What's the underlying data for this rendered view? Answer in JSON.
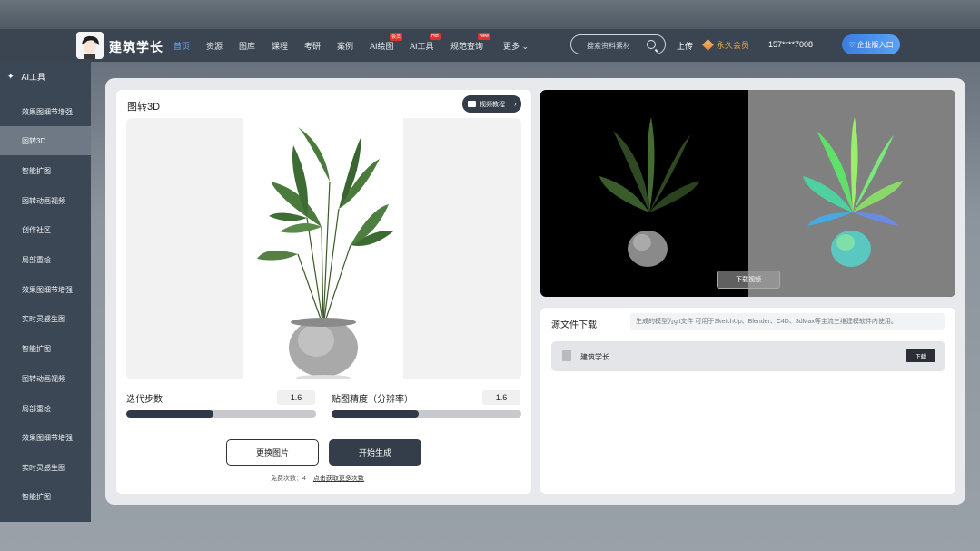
{
  "brand": {
    "name": "建筑学长"
  },
  "nav": {
    "items": [
      {
        "label": "首页",
        "active": true
      },
      {
        "label": "资源"
      },
      {
        "label": "图库"
      },
      {
        "label": "课程"
      },
      {
        "label": "考研"
      },
      {
        "label": "案例"
      },
      {
        "label": "AI绘图",
        "badge": "会员"
      },
      {
        "label": "AI工具",
        "badge": "Hot"
      },
      {
        "label": "规范查询",
        "badge": "New"
      },
      {
        "label": "更多"
      }
    ],
    "search_placeholder": "搜索资料素材",
    "upload": "上传",
    "vip": "永久会员",
    "phone": "157****7008",
    "enterprise": "企业版入口"
  },
  "sidebar": {
    "header": "AI工具",
    "items": [
      "效果图细节增强",
      "图转3D",
      "智能扩图",
      "图转动画视频",
      "创作社区",
      "局部重绘",
      "效果图细节增强",
      "实时灵感生图",
      "智能扩图",
      "图转动画视频",
      "局部重绘",
      "效果图细节增强",
      "实时灵感生图",
      "智能扩图"
    ],
    "active_index": 1
  },
  "tool": {
    "title": "图转3D",
    "video_tutorial": "视频教程",
    "params": [
      {
        "label": "迭代步数",
        "value": "1.6",
        "fill": 0.46
      },
      {
        "label": "贴图精度（分辨率）",
        "value": "1.6",
        "fill": 0.46
      }
    ],
    "change_image": "更换图片",
    "start": "开始生成",
    "free_count": "免费次数：4",
    "get_more": "点击获取更多次数"
  },
  "preview": {
    "download_video": "下载视频"
  },
  "source": {
    "title": "源文件下载",
    "hint": "生成的模型为glt文件  可用于SketchUp、Blender、C4D、3dMax等主流三维建模软件内使用。",
    "file_name": "建筑学长",
    "download": "下载"
  }
}
